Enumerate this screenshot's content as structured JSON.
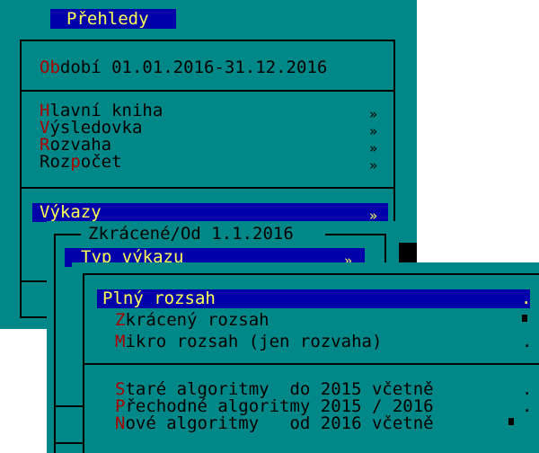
{
  "window": {
    "title": "Přehledy",
    "period": {
      "hot": "Ob",
      "rest": "dobí 01.01.2016-31.12.2016"
    }
  },
  "menu": {
    "items": [
      {
        "hot": "H",
        "rest": "lavní kniha",
        "arrow": "»"
      },
      {
        "hot": "V",
        "rest": "ýsledovka",
        "arrow": "»"
      },
      {
        "hot": "R",
        "rest": "ozvaha",
        "arrow": "»"
      },
      {
        "pre": "Roz",
        "hot": "p",
        "rest": "očet",
        "arrow": "»"
      }
    ],
    "selected": {
      "label": "Výkazy",
      "arrow": "»"
    }
  },
  "submenu": {
    "title": "Zkrácené/Od 1.1.2016",
    "selected": {
      "label": "Typ výkazu",
      "arrow": "»"
    }
  },
  "dropdown": {
    "options": [
      {
        "label": "Plný rozsah",
        "mark": ".",
        "selected": true
      },
      {
        "hot": "Z",
        "rest": "krácený rozsah",
        "mark": "▪"
      },
      {
        "hot": "M",
        "rest": "ikro rozsah (jen rozvaha)",
        "mark": "."
      },
      {
        "hot": "S",
        "rest": "taré algoritmy  do 2015 včetně",
        "mark": "."
      },
      {
        "hot": "P",
        "rest": "řechodné algoritmy 2015 / 2016",
        "mark": "."
      },
      {
        "hot": "N",
        "rest": "ové algoritmy   od 2016 včetně",
        "mark": "▪"
      }
    ]
  },
  "colors": {
    "background": "#008888",
    "selection": "#0000aa",
    "selection_text": "#ffff55",
    "hotkey": "#aa0000"
  }
}
